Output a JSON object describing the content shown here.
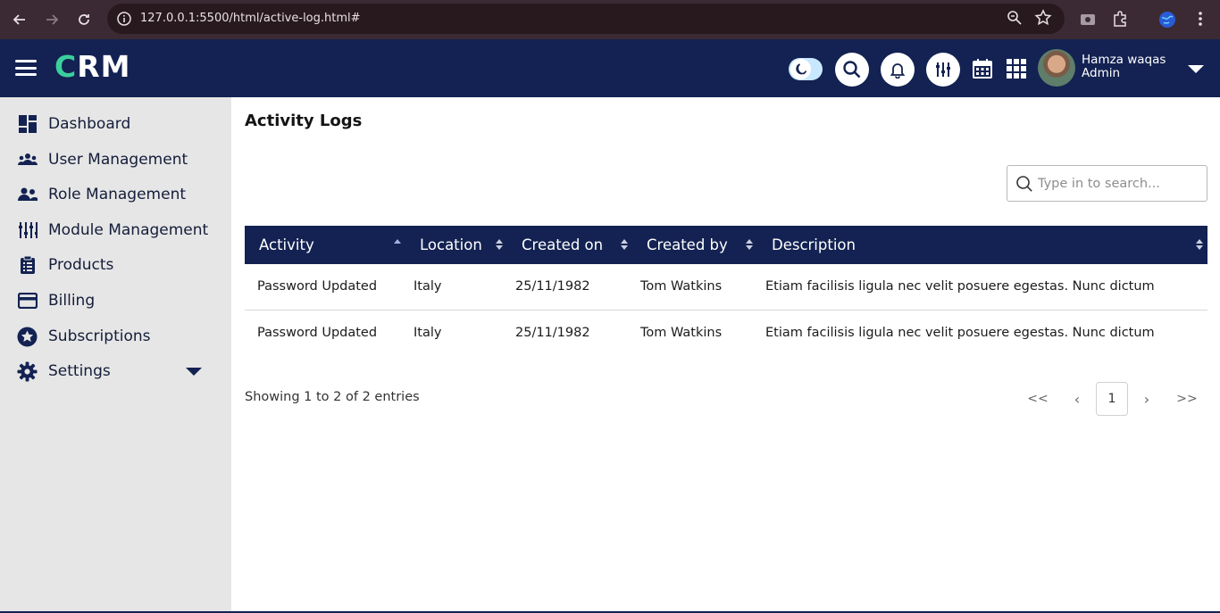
{
  "browser": {
    "url": "127.0.0.1:5500/html/active-log.html#"
  },
  "header": {
    "logo_c": "C",
    "logo_rest": "RM",
    "user_name": "Hamza waqas",
    "user_role": "Admin"
  },
  "sidebar": {
    "items": [
      {
        "label": "Dashboard",
        "icon": "dashboard-icon"
      },
      {
        "label": "User Management",
        "icon": "users-icon"
      },
      {
        "label": "Role Management",
        "icon": "people-icon"
      },
      {
        "label": "Module Management",
        "icon": "sliders-icon"
      },
      {
        "label": "Products",
        "icon": "clipboard-icon"
      },
      {
        "label": "Billing",
        "icon": "credit-card-icon"
      },
      {
        "label": "Subscriptions",
        "icon": "star-badge-icon"
      },
      {
        "label": "Settings",
        "icon": "gear-icon"
      }
    ]
  },
  "main": {
    "title": "Activity Logs",
    "search_placeholder": "Type in to search...",
    "columns": [
      "Activity",
      "Location",
      "Created on",
      "Created by",
      "Description"
    ],
    "rows": [
      [
        "Password Updated",
        "Italy",
        "25/11/1982",
        "Tom Watkins",
        "Etiam facilisis ligula nec velit posuere egestas. Nunc dictum"
      ],
      [
        "Password Updated",
        "Italy",
        "25/11/1982",
        "Tom Watkins",
        "Etiam facilisis ligula nec velit posuere egestas. Nunc dictum"
      ]
    ],
    "entries_text": "Showing 1 to 2 of 2 entries",
    "pager": {
      "first": "<<",
      "prev": "‹",
      "current": "1",
      "next": "›",
      "last": ">>"
    }
  },
  "colors": {
    "navy": "#132252",
    "accent": "#3ccf9e",
    "sidebar_bg": "#e6e6e6"
  }
}
